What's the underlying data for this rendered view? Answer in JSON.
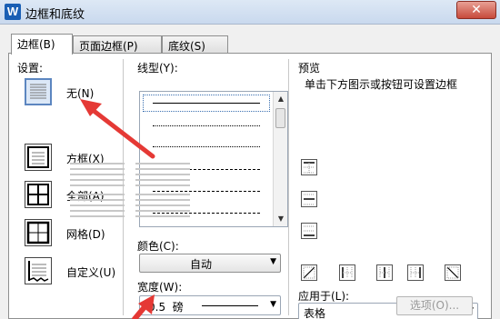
{
  "window": {
    "title": "边框和底纹",
    "close_symbol": "✕"
  },
  "tabs": [
    {
      "label": "边框(B)",
      "active": true
    },
    {
      "label": "页面边框(P)",
      "active": false
    },
    {
      "label": "底纹(S)",
      "active": false
    }
  ],
  "settings": {
    "heading": "设置:",
    "options": [
      {
        "label": "无(N)",
        "selected": true
      },
      {
        "label": "方框(X)",
        "selected": false
      },
      {
        "label": "全部(A)",
        "selected": false
      },
      {
        "label": "网格(D)",
        "selected": false
      },
      {
        "label": "自定义(U)",
        "selected": false
      }
    ]
  },
  "line_style": {
    "heading": "线型(Y):"
  },
  "color": {
    "heading": "颜色(C):",
    "value": "自动"
  },
  "width": {
    "heading": "宽度(W):",
    "value": "0.5  磅"
  },
  "preview": {
    "heading": "预览",
    "hint": "单击下方图示或按钮可设置边框"
  },
  "apply_to": {
    "heading": "应用于(L):",
    "value": "表格"
  },
  "options_button": "选项(O)...",
  "colors": {
    "accent": "#1a5fb4",
    "arrow": "#e53935",
    "selection": "#5c86c0"
  }
}
